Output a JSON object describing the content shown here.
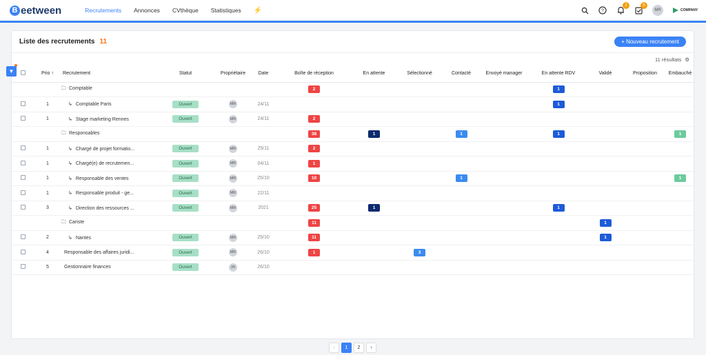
{
  "app": {
    "logo_letter": "B",
    "logo_rest": "eetween",
    "company": "COMPANY"
  },
  "nav": [
    "Recrutements",
    "Annonces",
    "CVthèque",
    "Statistiques"
  ],
  "notifications": {
    "bell": "2",
    "tasks": "5"
  },
  "user": "MR",
  "list": {
    "title": "Liste des recrutements",
    "count": "11",
    "new_button": "+ Nouveau recrutement",
    "results": "11 résultats"
  },
  "columns": [
    "",
    "Prio ↑",
    "Recrutement",
    "Statut",
    "Propriétaire",
    "Date",
    "Boîte de réception",
    "En attente",
    "Sélectionné",
    "Contacté",
    "Envoyé manager",
    "En attente RDV",
    "Validé",
    "Proposition",
    "Embauché"
  ],
  "pagination": {
    "prev": "‹",
    "pages": [
      "1",
      "2"
    ],
    "next": "›"
  },
  "colors": {
    "accent": "#3b82f6",
    "count": "#f97316"
  },
  "rows": [
    {
      "type": "group",
      "name": "Comptable",
      "counts": {
        "inbox": "2",
        "rdv": "1"
      }
    },
    {
      "type": "row",
      "prio": "1",
      "name": "Comptable Paris",
      "child": true,
      "status": "Ouvert",
      "owner": "MR",
      "date": "24/11",
      "counts": {
        "rdv": "1"
      }
    },
    {
      "type": "row",
      "prio": "1",
      "name": "Stage marketing Rennes",
      "child": true,
      "status": "Ouvert",
      "owner": "MR",
      "date": "24/11",
      "counts": {
        "inbox": "2"
      }
    },
    {
      "type": "group",
      "name": "Responsables",
      "counts": {
        "inbox": "38",
        "wait": "1",
        "contact": "1",
        "rdv": "1",
        "hired": "1"
      }
    },
    {
      "type": "row",
      "prio": "1",
      "name": "Chargé de projet formatio...",
      "child": true,
      "status": "Ouvert",
      "owner": "MR",
      "date": "25/11",
      "counts": {
        "inbox": "2"
      }
    },
    {
      "type": "row",
      "prio": "1",
      "name": "Chargé(e) de recrutemen...",
      "child": true,
      "status": "Ouvert",
      "owner": "MR",
      "date": "04/11",
      "counts": {
        "inbox": "1"
      }
    },
    {
      "type": "row",
      "prio": "1",
      "name": "Responsable des ventes",
      "child": true,
      "status": "Ouvert",
      "owner": "MR",
      "date": "25/10",
      "counts": {
        "inbox": "10",
        "contact": "1",
        "hired": "1"
      }
    },
    {
      "type": "row",
      "prio": "1",
      "name": "Responsable produit - ge...",
      "child": true,
      "status": "Ouvert",
      "owner": "MR",
      "date": "22/11",
      "counts": {}
    },
    {
      "type": "row",
      "prio": "3",
      "name": "Direction des ressources ...",
      "child": true,
      "status": "Ouvert",
      "owner": "MR",
      "date": "2021",
      "counts": {
        "inbox": "25",
        "wait": "1",
        "rdv": "1"
      }
    },
    {
      "type": "group",
      "name": "Cariste",
      "counts": {
        "inbox": "11",
        "valid": "1"
      }
    },
    {
      "type": "row",
      "prio": "2",
      "name": "Nantes",
      "child": true,
      "status": "Ouvert",
      "owner": "MR",
      "date": "25/10",
      "counts": {
        "inbox": "11",
        "valid": "1"
      }
    },
    {
      "type": "row",
      "prio": "4",
      "name": "Responsable des affaires juridi...",
      "child": false,
      "status": "Ouvert",
      "owner": "MR",
      "date": "26/10",
      "counts": {
        "inbox": "1",
        "selected": "3"
      }
    },
    {
      "type": "row",
      "prio": "5",
      "name": "Gestionnaire finances",
      "child": false,
      "status": "Ouvert",
      "owner": "JR",
      "date": "26/10",
      "counts": {}
    }
  ]
}
